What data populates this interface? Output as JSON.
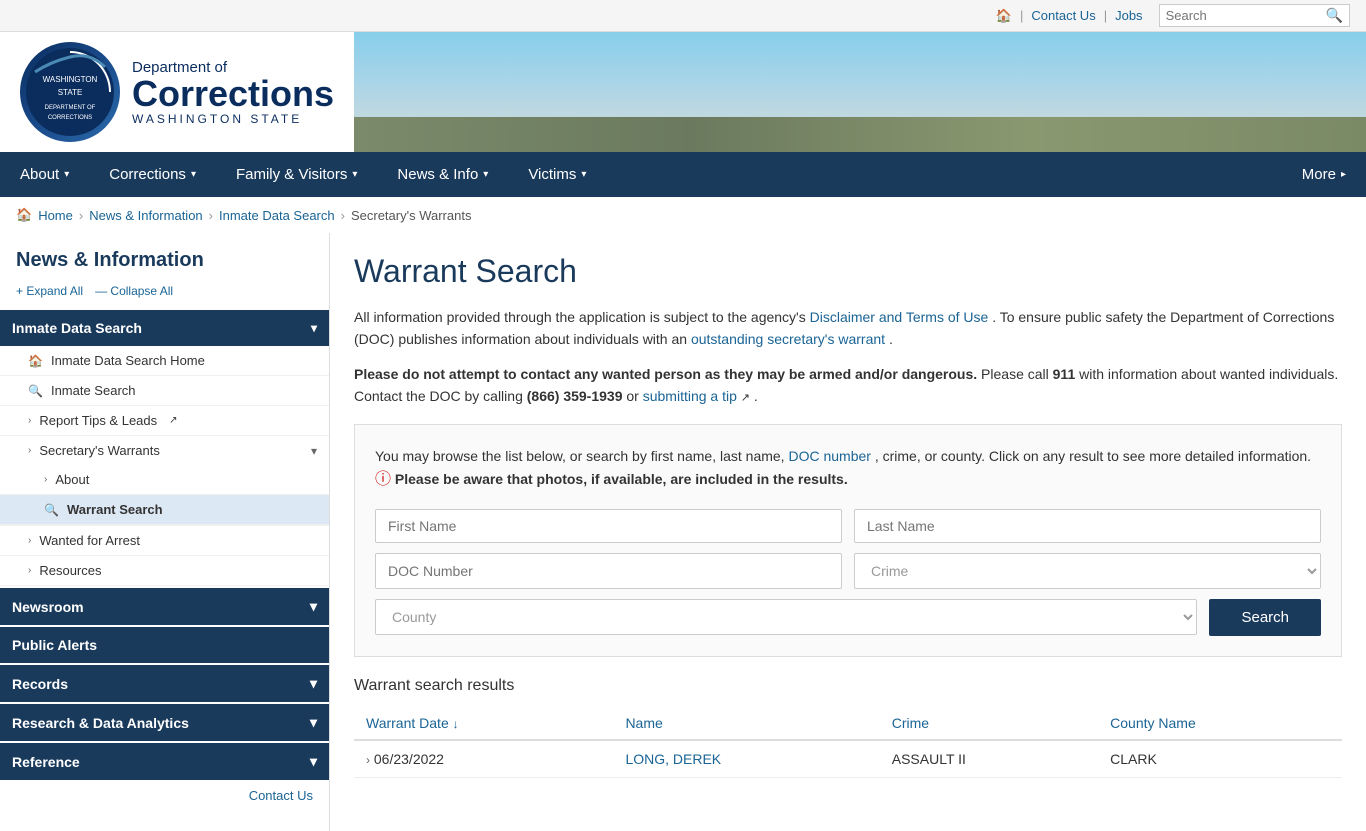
{
  "utility": {
    "home_icon": "🏠",
    "links": [
      "Contact Us",
      "Jobs"
    ],
    "search_placeholder": "Search"
  },
  "header": {
    "logo_dept": "Department of",
    "logo_name": "Corrections",
    "logo_state": "WASHINGTON STATE"
  },
  "nav": {
    "items": [
      {
        "label": "About",
        "has_arrow": true
      },
      {
        "label": "Corrections",
        "has_arrow": true
      },
      {
        "label": "Family & Visitors",
        "has_arrow": true
      },
      {
        "label": "News & Info",
        "has_arrow": true
      },
      {
        "label": "Victims",
        "has_arrow": true
      },
      {
        "label": "More",
        "has_arrow": true
      }
    ]
  },
  "breadcrumb": {
    "items": [
      "Home",
      "News & Information",
      "Inmate Data Search",
      "Secretary's Warrants"
    ]
  },
  "sidebar": {
    "title": "News & Information",
    "expand_all": "+ Expand All",
    "collapse_all": "— Collapse All",
    "sections": [
      {
        "label": "Inmate Data Search",
        "expanded": true,
        "items": [
          {
            "label": "Inmate Data Search Home",
            "icon": "🏠",
            "level": 2
          },
          {
            "label": "Inmate Search",
            "icon": "🔍",
            "level": 2
          },
          {
            "label": "Report Tips & Leads",
            "icon": "›",
            "level": 2,
            "expandable": true,
            "external": true
          },
          {
            "label": "Secretary's Warrants",
            "icon": "›",
            "level": 2,
            "expandable": true,
            "expanded": true,
            "subitems": [
              {
                "label": "About",
                "icon": "›",
                "level": 3
              },
              {
                "label": "Warrant Search",
                "icon": "🔍",
                "level": 3,
                "active": true
              }
            ]
          },
          {
            "label": "Wanted for Arrest",
            "icon": "›",
            "level": 2,
            "expandable": true
          },
          {
            "label": "Resources",
            "icon": "›",
            "level": 2,
            "expandable": true
          }
        ]
      }
    ],
    "collapsed_sections": [
      "Newsroom",
      "Public Alerts",
      "Records",
      "Research & Data Analytics",
      "Reference"
    ],
    "contact_us": "Contact Us"
  },
  "content": {
    "page_title": "Warrant Search",
    "intro_text_1": "All information provided through the application is subject to the agency's",
    "disclaimer_link": "Disclaimer and Terms of Use",
    "intro_text_2": ". To ensure public safety the Department of Corrections (DOC) publishes information about individuals with an",
    "warrant_link": "outstanding secretary's warrant",
    "intro_text_3": ".",
    "warning_bold": "Please do not attempt to contact any wanted person as they may be armed and/or dangerous.",
    "warning_text_1": " Please call ",
    "warning_phone_bold": "911",
    "warning_text_2": " with information about wanted individuals. Contact the DOC by calling ",
    "warning_phone2_bold": "(866) 359-1939",
    "warning_text_3": " or ",
    "submit_tip_link": "submitting a tip",
    "warning_text_4": ".",
    "search_panel": {
      "instruction_1": "You may browse the list below, or search by first name, last name,",
      "doc_number_link": "DOC number",
      "instruction_2": ", crime, or county. Click on any result to see more detailed information.",
      "photo_warning_bold": "Please be aware that photos, if available, are included in the results.",
      "first_name_placeholder": "First Name",
      "last_name_placeholder": "Last Name",
      "doc_number_placeholder": "DOC Number",
      "crime_placeholder": "Crime",
      "county_placeholder": "County",
      "search_button": "Search"
    },
    "results": {
      "title": "Warrant search results",
      "columns": [
        "Warrant Date",
        "Name",
        "Crime",
        "County Name"
      ],
      "sort_col": 0,
      "sort_arrow": "↓",
      "rows": [
        {
          "date": "06/23/2022",
          "name": "LONG, DEREK",
          "crime": "ASSAULT II",
          "county": "CLARK"
        }
      ]
    }
  }
}
